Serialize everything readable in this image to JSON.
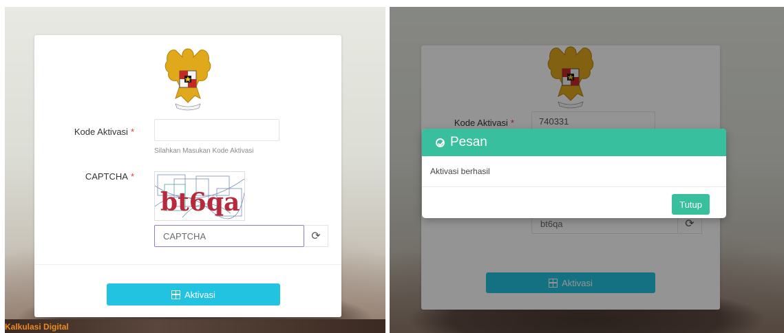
{
  "left": {
    "form": {
      "kode_label": "Kode Aktivasi",
      "required_mark": "*",
      "kode_value": "",
      "kode_help": "Silahkan Masukan Kode Aktivasi",
      "captcha_label": "CAPTCHA",
      "captcha_text": "bt6qa",
      "captcha_placeholder": "CAPTCHA"
    },
    "button": "Aktivasi",
    "footer_brand": "Kalkulasi Digital"
  },
  "right": {
    "form": {
      "kode_label": "Kode Aktivasi",
      "required_mark": "*",
      "kode_value": "740331",
      "captcha_value": "bt6qa"
    },
    "button": "Aktivasi",
    "modal": {
      "title": "Pesan",
      "message": "Aktivasi berhasil",
      "close_button": "Tutup"
    }
  },
  "colors": {
    "primary_button": "#22c3e0",
    "modal_accent": "#38bf9d",
    "required": "#e23c3c",
    "captcha_border": "#8c7ad6"
  },
  "icons": [
    "garuda-emblem-icon",
    "refresh-icon",
    "grid-icon",
    "check-circle-icon"
  ]
}
